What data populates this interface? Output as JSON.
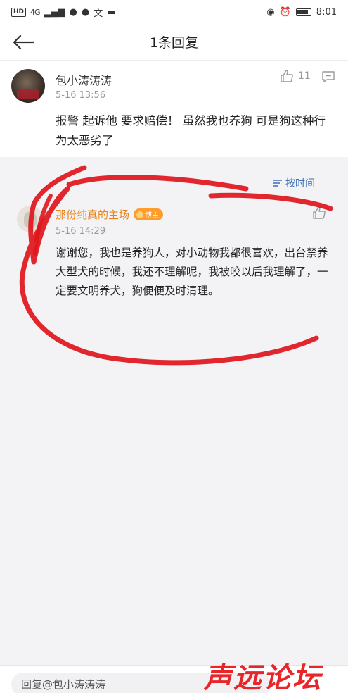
{
  "status_bar": {
    "hd": "HD",
    "network": "4G",
    "time": "8:01"
  },
  "header": {
    "title": "1条回复"
  },
  "main_comment": {
    "username": "包小涛涛涛",
    "time": "5-16 13:56",
    "like_count": "11",
    "text": "报警 起诉他 要求赔偿！ 虽然我也养狗 可是狗这种行为太恶劣了"
  },
  "sort": {
    "label": "按时间"
  },
  "reply": {
    "username": "那份纯真的主场",
    "badge": "博主",
    "time": "5-16 14:29",
    "text": "谢谢您，我也是养狗人，对小动物我都很喜欢，出台禁养大型犬的时候，我还不理解呢，我被咬以后我理解了，一定要文明养犬，狗便便及时清理。"
  },
  "bottom_bar": {
    "placeholder": "回复@包小涛涛涛"
  },
  "watermark": {
    "text": "声远论坛"
  },
  "colors": {
    "accent_blue": "#3b6fb6",
    "author_orange": "#e8821a",
    "scribble_red": "#e0151c"
  }
}
